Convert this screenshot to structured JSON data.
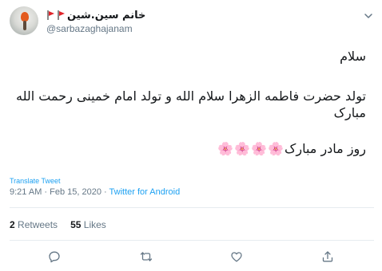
{
  "user": {
    "display_name": "خانم سین.شین",
    "handle": "@sarbazaghajanam",
    "badges": [
      "flag-icon",
      "flag-icon"
    ]
  },
  "tweet": {
    "line1": "سلام",
    "line2": "تولد حضرت فاطمه الزهرا سلام الله و تولد امام خمینی رحمت الله مبارک",
    "line3": "روز مادر مبارک",
    "emoji": "🌸",
    "emoji_count": 4
  },
  "translate_label": "Translate Tweet",
  "meta": {
    "time_date": "9:21 AM · Feb 15, 2020 · ",
    "source": "Twitter for Android"
  },
  "stats": {
    "retweets_count": "2",
    "retweets_label": "Retweets",
    "likes_count": "55",
    "likes_label": "Likes"
  },
  "colors": {
    "accent": "#1da1f2",
    "muted": "#657786",
    "text": "#14171a",
    "divider": "#e6ecf0"
  },
  "actions": [
    "reply-icon",
    "retweet-icon",
    "like-icon",
    "share-icon"
  ]
}
